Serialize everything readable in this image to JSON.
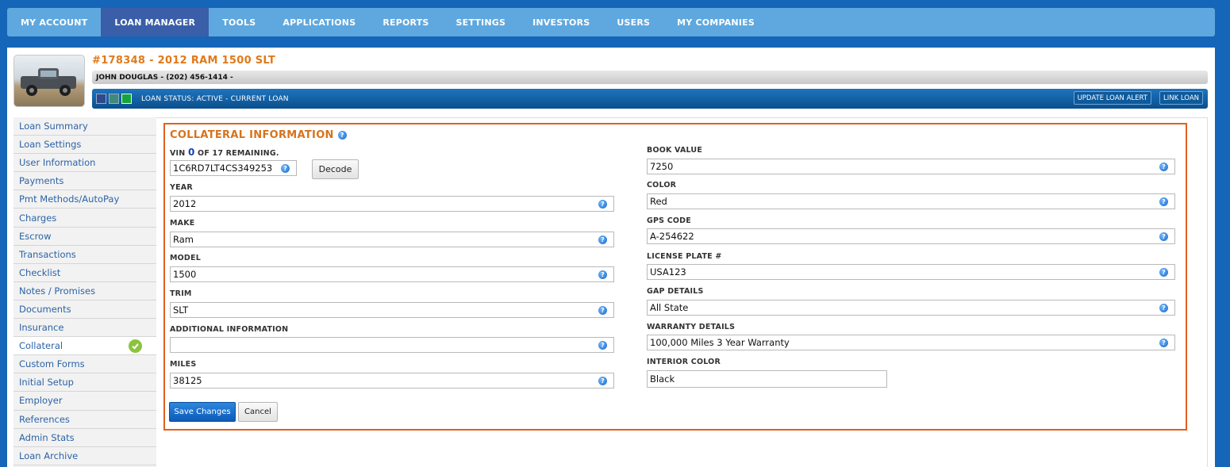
{
  "nav": {
    "items": [
      {
        "label": "MY ACCOUNT"
      },
      {
        "label": "LOAN MANAGER"
      },
      {
        "label": "TOOLS"
      },
      {
        "label": "APPLICATIONS"
      },
      {
        "label": "REPORTS"
      },
      {
        "label": "SETTINGS"
      },
      {
        "label": "INVESTORS"
      },
      {
        "label": "USERS"
      },
      {
        "label": "MY COMPANIES"
      }
    ],
    "active": "LOAN MANAGER"
  },
  "loan": {
    "title": "#178348 - 2012 RAM 1500 SLT",
    "borrower": "JOHN DOUGLAS - (202) 456-1414 -",
    "status": "LOAN STATUS: ACTIVE - CURRENT LOAN",
    "update_alert_label": "UPDATE LOAN ALERT",
    "link_loan_label": "LINK LOAN"
  },
  "sidebar": {
    "items": [
      {
        "label": "Loan Summary"
      },
      {
        "label": "Loan Settings"
      },
      {
        "label": "User Information"
      },
      {
        "label": "Payments"
      },
      {
        "label": "Pmt Methods/AutoPay"
      },
      {
        "label": "Charges"
      },
      {
        "label": "Escrow"
      },
      {
        "label": "Transactions"
      },
      {
        "label": "Checklist"
      },
      {
        "label": "Notes / Promises"
      },
      {
        "label": "Documents"
      },
      {
        "label": "Insurance"
      },
      {
        "label": "Collateral"
      },
      {
        "label": "Custom Forms"
      },
      {
        "label": "Initial Setup"
      },
      {
        "label": "Employer"
      },
      {
        "label": "References"
      },
      {
        "label": "Admin Stats"
      },
      {
        "label": "Loan Archive"
      }
    ],
    "active": "Collateral"
  },
  "collateral": {
    "title": "COLLATERAL INFORMATION",
    "vin_prefix": "VIN",
    "vin_count": "0",
    "vin_suffix": "OF 17 REMAINING.",
    "vin_value": "1C6RD7LT4CS349253",
    "decode_label": "Decode",
    "left_fields": [
      {
        "label": "YEAR",
        "value": "2012"
      },
      {
        "label": "MAKE",
        "value": "Ram"
      },
      {
        "label": "MODEL",
        "value": "1500"
      },
      {
        "label": "TRIM",
        "value": "SLT"
      },
      {
        "label": "ADDITIONAL INFORMATION",
        "value": ""
      },
      {
        "label": "MILES",
        "value": "38125"
      }
    ],
    "right_fields": [
      {
        "label": "BOOK VALUE",
        "value": "7250"
      },
      {
        "label": "COLOR",
        "value": "Red"
      },
      {
        "label": "GPS CODE",
        "value": "A-254622"
      },
      {
        "label": "LICENSE PLATE #",
        "value": "USA123"
      },
      {
        "label": "GAP DETAILS",
        "value": "All State"
      },
      {
        "label": "WARRANTY DETAILS",
        "value": "100,000 Miles 3 Year Warranty"
      },
      {
        "label": "INTERIOR COLOR",
        "value": "Black"
      }
    ],
    "save_label": "Save Changes",
    "cancel_label": "Cancel"
  },
  "colors": {
    "background": "#1565b8",
    "nav": "#5ea8df",
    "nav_active": "#3a5ea8",
    "title_orange": "#e07a1a",
    "highlight_border": "#e06020",
    "link_blue": "#2c63a6"
  },
  "icons": {
    "help": "question-help-icon",
    "check": "check-circle-icon"
  }
}
